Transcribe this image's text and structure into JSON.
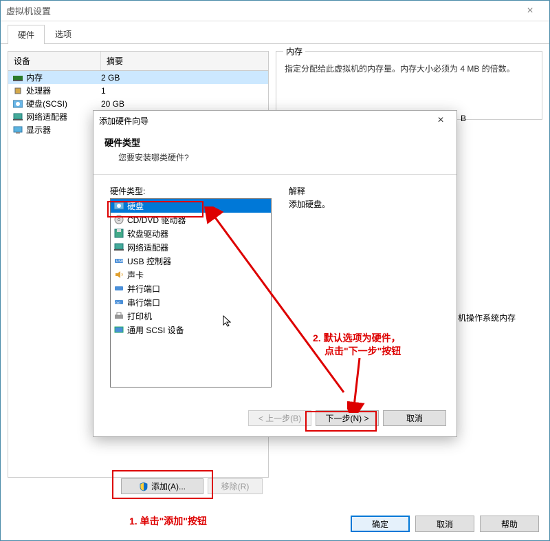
{
  "main": {
    "title": "虚拟机设置",
    "tabs": [
      "硬件",
      "选项"
    ],
    "list_headers": [
      "设备",
      "摘要"
    ],
    "devices": [
      {
        "name": "内存",
        "summary": "2 GB"
      },
      {
        "name": "处理器",
        "summary": "1"
      },
      {
        "name": "硬盘(SCSI)",
        "summary": "20 GB"
      },
      {
        "name": "网络适配器",
        "summary": ""
      },
      {
        "name": "显示器",
        "summary": ""
      }
    ],
    "memory_group_title": "内存",
    "memory_text": "指定分配给此虚拟机的内存量。内存大小必须为 4 MB 的倍数。",
    "truncated_b": "B",
    "truncated_os": "机操作系统内存",
    "add_btn": "添加(A)...",
    "remove_btn": "移除(R)",
    "ok_btn": "确定",
    "cancel_btn": "取消",
    "help_btn": "帮助"
  },
  "wizard": {
    "title": "添加硬件向导",
    "header_title": "硬件类型",
    "header_sub": "您要安装哪类硬件?",
    "list_label": "硬件类型:",
    "explain_label": "解释",
    "explain_text": "添加硬盘。",
    "items": [
      "硬盘",
      "CD/DVD 驱动器",
      "软盘驱动器",
      "网络适配器",
      "USB 控制器",
      "声卡",
      "并行端口",
      "串行端口",
      "打印机",
      "通用 SCSI 设备"
    ],
    "back_btn": "< 上一步(B)",
    "next_btn": "下一步(N) >",
    "cancel_btn": "取消"
  },
  "annotations": {
    "step1": "1.  单击\"添加\"按钮",
    "step2_line1": "2.  默认选项为硬件，",
    "step2_line2": "点击\"下一步\"按钮"
  }
}
